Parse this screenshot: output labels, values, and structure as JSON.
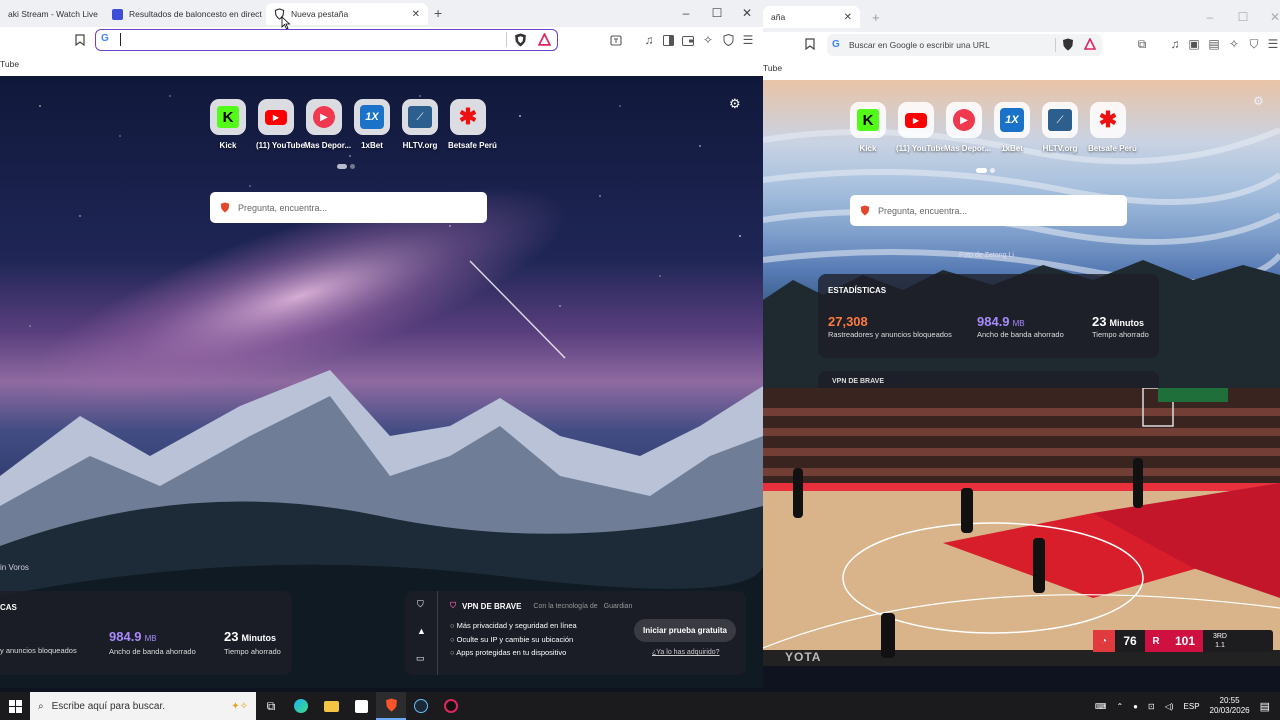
{
  "left_browser": {
    "tabs": [
      {
        "title": "aki Stream - Watch Live c",
        "active": false
      },
      {
        "title": "Resultados de baloncesto en directo",
        "active": false
      },
      {
        "title": "Nueva pestaña",
        "active": true
      }
    ],
    "new_tab_symbol": "+",
    "window_controls": [
      "–",
      "☐",
      "✕"
    ],
    "bookmark_bar": {
      "visible_item": "Tube"
    },
    "omnibox": {
      "value": "",
      "search_engine_icon": "G"
    },
    "top_sites": [
      {
        "label": "Kick",
        "icon": "kick-icon",
        "color": "#53fc18"
      },
      {
        "label": "(11) YouTube",
        "icon": "youtube-icon",
        "color": "#ff0000"
      },
      {
        "label": "Mas Depor...",
        "icon": "play-icon",
        "color": "#f0384e"
      },
      {
        "label": "1xBet",
        "icon": "onexbet-icon",
        "color": "#1a73c8"
      },
      {
        "label": "HLTV.org",
        "icon": "hltv-icon",
        "color": "#2d5f8e"
      },
      {
        "label": "Betsafe Perú",
        "icon": "betsafe-icon",
        "color": "#e11"
      }
    ],
    "search_placeholder": "Pregunta, encuentra...",
    "photo_credit": "in Voros",
    "stats": {
      "header": "CAS",
      "trackers_label": "y anuncios bloqueados",
      "bandwidth_value": "984.9",
      "bandwidth_unit": "MB",
      "bandwidth_label": "Ancho de banda ahorrado",
      "time_value": "23",
      "time_unit": "Minutos",
      "time_label": "Tiempo ahorrado"
    },
    "vpn": {
      "title": "VPN DE BRAVE",
      "powered": "Con la tecnología de",
      "powered_brand": "Guardian",
      "features": [
        "Más privacidad y seguridad en línea",
        "Oculte su IP y cambie su ubicación",
        "Apps protegidas en tu dispositivo"
      ],
      "cta": "Iniciar prueba gratuita",
      "link": "¿Ya lo has adquirido?"
    }
  },
  "right_browser": {
    "tab_title": "aña",
    "new_tab_symbol": "+",
    "window_controls": [
      "–",
      "☐",
      "✕"
    ],
    "omnibox_placeholder": "Buscar en Google o escribir una URL",
    "bookmark_bar": {
      "visible_item": "Tube"
    },
    "top_sites": [
      {
        "label": "Kick"
      },
      {
        "label": "(11) YouTube"
      },
      {
        "label": "Mas Depor..."
      },
      {
        "label": "1xBet"
      },
      {
        "label": "HLTV.org"
      },
      {
        "label": "Betsafe Perú"
      }
    ],
    "search_placeholder": "Pregunta, encuentra...",
    "photo_credit": "Foto de Zetong Li",
    "stats": {
      "header": "ESTADÍSTICAS",
      "trackers_value": "27,308",
      "trackers_label": "Rastreadores y anuncios bloqueados",
      "bandwidth_value": "984.9",
      "bandwidth_unit": "MB",
      "bandwidth_label": "Ancho de banda ahorrado",
      "time_value": "23",
      "time_unit": "Minutos",
      "time_label": "Tiempo ahorrado"
    },
    "vpn_partial": "VPN DE BRAVE"
  },
  "video": {
    "scoreboard": {
      "away_score": "76",
      "home_score": "101",
      "period": "3RD",
      "clock": "1.1"
    },
    "arena_sign": "YOTA"
  },
  "taskbar": {
    "search_placeholder": "Escribe aquí para buscar.",
    "language": "ESP",
    "time": "20:55",
    "date": "20/03/2026"
  },
  "colors": {
    "brave_accent": "#6b3fd2",
    "stats_orange": "#ff7a3d",
    "stats_purple": "#a78bfa",
    "cta_bg": "#3a3a42"
  }
}
